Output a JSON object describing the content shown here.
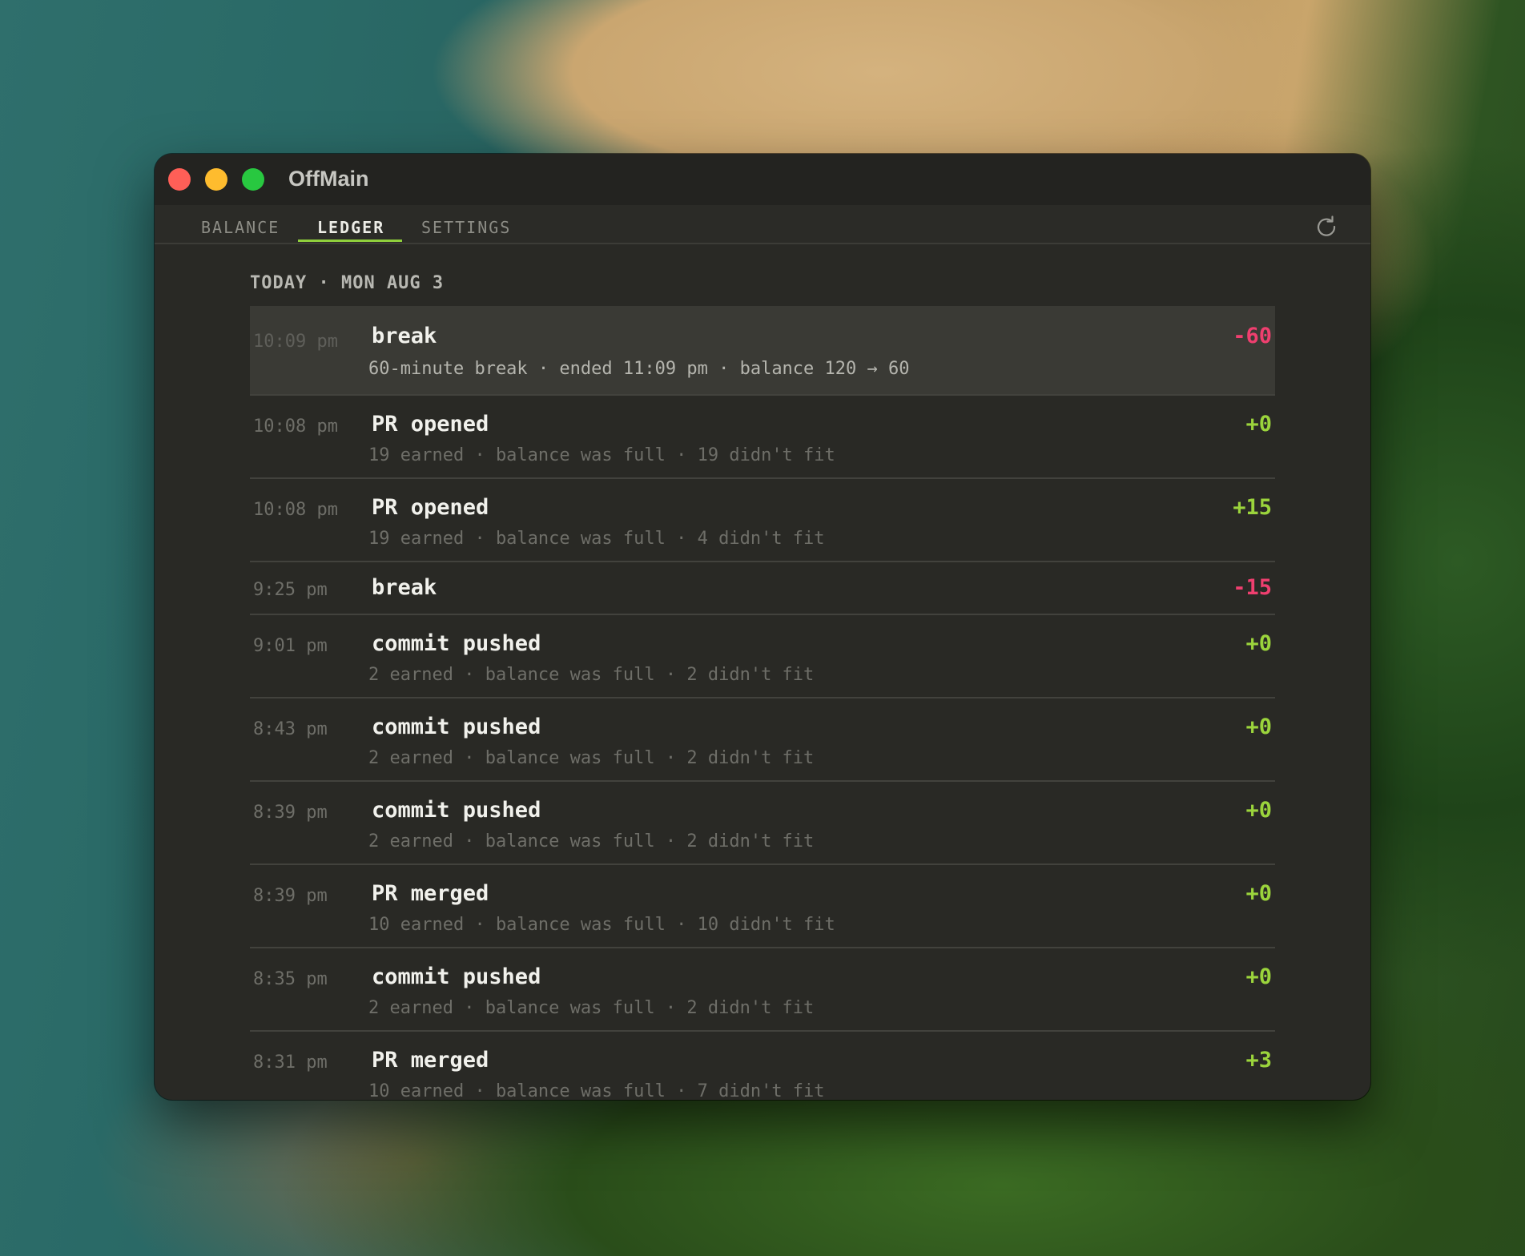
{
  "app": {
    "title": "OffMain"
  },
  "tabs": {
    "balance": "BALANCE",
    "ledger": "LEDGER",
    "settings": "SETTINGS",
    "active": "LEDGER"
  },
  "ledger": {
    "date_header": "TODAY · MON AUG 3",
    "entries": [
      {
        "time": "10:09 pm",
        "title": "break",
        "detail": "60-minute break · ended 11:09 pm · balance 120 → 60",
        "delta": "-60",
        "kind": "neg",
        "selected": true
      },
      {
        "time": "10:08 pm",
        "title": "PR opened",
        "detail": "19 earned · balance was full · 19 didn't fit",
        "delta": "+0",
        "kind": "pos"
      },
      {
        "time": "10:08 pm",
        "title": "PR opened",
        "detail": "19 earned · balance was full · 4 didn't fit",
        "delta": "+15",
        "kind": "pos"
      },
      {
        "time": "9:25 pm",
        "title": "break",
        "detail": "",
        "delta": "-15",
        "kind": "neg"
      },
      {
        "time": "9:01 pm",
        "title": "commit pushed",
        "detail": "2 earned · balance was full · 2 didn't fit",
        "delta": "+0",
        "kind": "pos"
      },
      {
        "time": "8:43 pm",
        "title": "commit pushed",
        "detail": "2 earned · balance was full · 2 didn't fit",
        "delta": "+0",
        "kind": "pos"
      },
      {
        "time": "8:39 pm",
        "title": "commit pushed",
        "detail": "2 earned · balance was full · 2 didn't fit",
        "delta": "+0",
        "kind": "pos"
      },
      {
        "time": "8:39 pm",
        "title": "PR merged",
        "detail": "10 earned · balance was full · 10 didn't fit",
        "delta": "+0",
        "kind": "pos"
      },
      {
        "time": "8:35 pm",
        "title": "commit pushed",
        "detail": "2 earned · balance was full · 2 didn't fit",
        "delta": "+0",
        "kind": "pos"
      },
      {
        "time": "8:31 pm",
        "title": "PR merged",
        "detail": "10 earned · balance was full · 7 didn't fit",
        "delta": "+3",
        "kind": "pos"
      }
    ]
  },
  "colors": {
    "negative": "#ef3f6f",
    "positive": "#9bd43c",
    "tab_accent": "#8fcf3c",
    "window_bg": "#292925"
  },
  "icons": {
    "refresh": "refresh-icon"
  }
}
